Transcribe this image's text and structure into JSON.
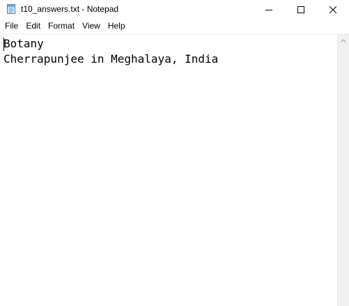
{
  "window": {
    "title": "t10_answers.txt - Notepad"
  },
  "icons": {
    "app": "notepad-icon",
    "minimize": "minimize-icon",
    "maximize": "maximize-icon",
    "close": "close-icon",
    "scroll_up": "chevron-up-icon"
  },
  "menu": {
    "items": [
      {
        "label": "File"
      },
      {
        "label": "Edit"
      },
      {
        "label": "Format"
      },
      {
        "label": "View"
      },
      {
        "label": "Help"
      }
    ]
  },
  "editor": {
    "lines": [
      "Botany",
      "Cherrapunjee in Meghalaya, India"
    ]
  }
}
